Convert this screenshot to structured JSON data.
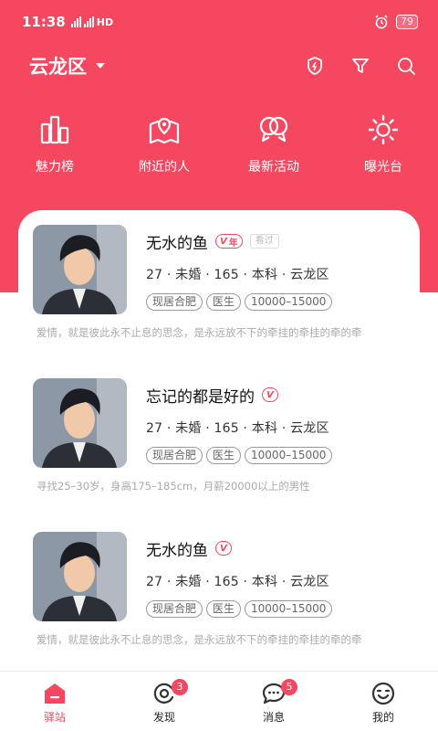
{
  "status_bar": {
    "time": "11:38",
    "network": "HD",
    "battery": "79"
  },
  "header": {
    "location": "云龙区",
    "icons": [
      "shield-lightning-icon",
      "filter-icon",
      "search-icon"
    ]
  },
  "quick_nav": [
    {
      "label": "魅力榜",
      "icon": "ranking-icon"
    },
    {
      "label": "附近的人",
      "icon": "map-pin-icon"
    },
    {
      "label": "最新活动",
      "icon": "chat-bubbles-icon"
    },
    {
      "label": "曝光台",
      "icon": "sun-icon"
    }
  ],
  "profiles": [
    {
      "name": "无水的鱼",
      "verified": "V",
      "vip": "年",
      "seen": "看过",
      "attrs": "27 · 未婚 · 165 · 本科 · 云龙区",
      "tags": [
        "现居合肥",
        "医生",
        "10000–15000"
      ],
      "desc": "爱情，就是彼此永不止息的思念，是永远放不下的牵挂的牵挂的牵的牵"
    },
    {
      "name": "忘记的都是好的",
      "verified": "V",
      "attrs": "27 · 未婚 · 165 · 本科 · 云龙区",
      "tags": [
        "现居合肥",
        "医生",
        "10000–15000"
      ],
      "desc": "寻找25–30岁，身高175–185cm，月薪20000以上的男性"
    },
    {
      "name": "无水的鱼",
      "verified": "V",
      "attrs": "27 · 未婚 · 165 · 本科 · 云龙区",
      "tags": [
        "现居合肥",
        "医生",
        "10000–15000"
      ],
      "desc": "爱情，就是彼此永不止息的思念，是永远放不下的牵挂的牵挂的牵的牵"
    }
  ],
  "tabbar": [
    {
      "label": "驿站",
      "icon": "home-icon",
      "active": true
    },
    {
      "label": "发现",
      "icon": "discover-icon",
      "badge": "3"
    },
    {
      "label": "消息",
      "icon": "message-icon",
      "badge": "5"
    },
    {
      "label": "我的",
      "icon": "profile-icon"
    }
  ],
  "colors": {
    "accent": "#f5475f",
    "background": "#ffffff"
  }
}
